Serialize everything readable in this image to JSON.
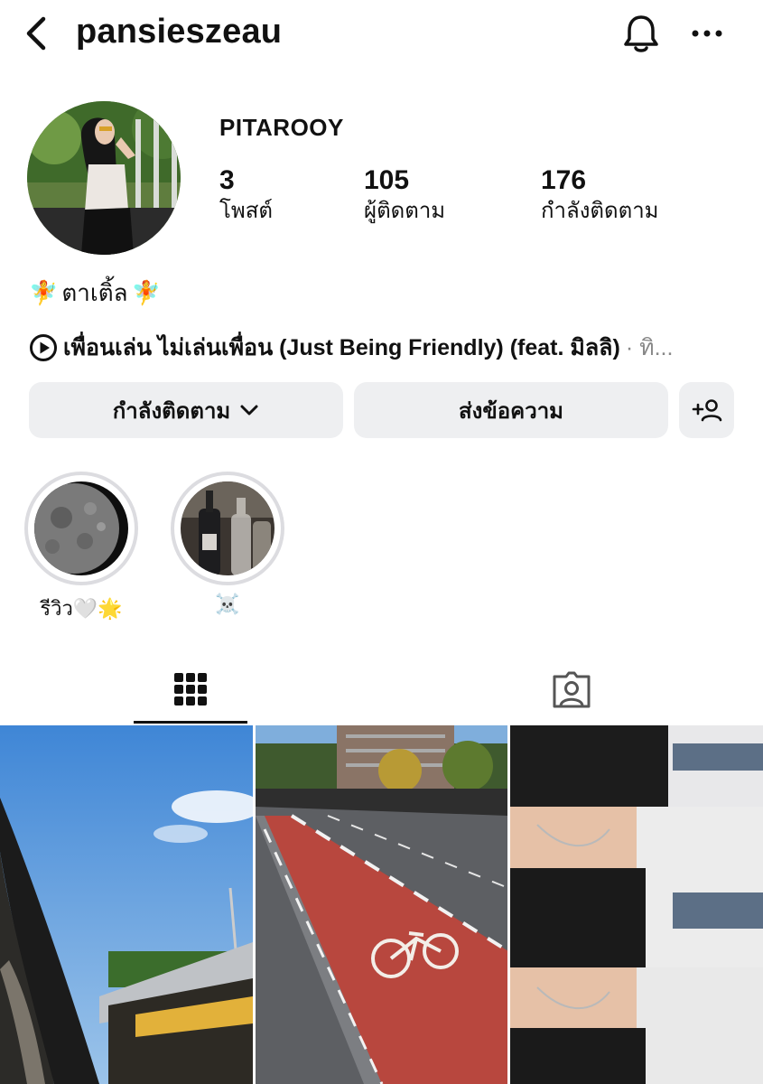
{
  "header": {
    "username": "pansieszeau"
  },
  "profile": {
    "display_name": "PITAROOY",
    "stats": [
      {
        "value": "3",
        "label": "โพสต์"
      },
      {
        "value": "105",
        "label": "ผู้ติดตาม"
      },
      {
        "value": "176",
        "label": "กำลังติดตาม"
      }
    ],
    "bio": "ตาเติ้ล",
    "bio_emoji": "🧚",
    "music": {
      "song": "เพื่อนเล่น ไม่เล่นเพื่อน (Just Being Friendly) (feat. มิลลิ)",
      "suffix": "· ทิ..."
    }
  },
  "actions": {
    "following_label": "กำลังติดตาม",
    "message_label": "ส่งข้อความ"
  },
  "highlights": [
    {
      "label": "รีวิว🤍🌟"
    },
    {
      "label": "☠️"
    }
  ],
  "tabs": [
    "grid-icon",
    "tagged-icon"
  ],
  "colors": {
    "button_bg": "#eeeff1",
    "text": "#111111",
    "bike_lane": "#c2443a",
    "sky": "#4a8fd8"
  }
}
